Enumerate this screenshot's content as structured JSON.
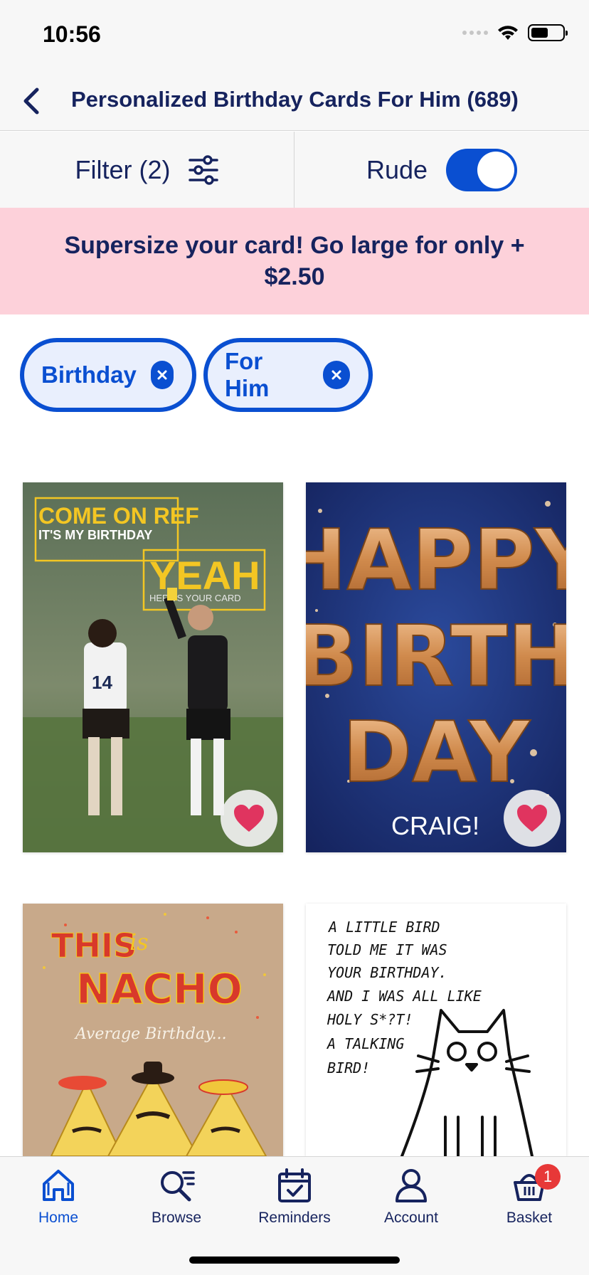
{
  "status_bar": {
    "time": "10:56"
  },
  "header": {
    "title": "Personalized Birthday Cards For Him (689)"
  },
  "filter_bar": {
    "filter_label": "Filter (2)",
    "rude_label": "Rude",
    "rude_enabled": true
  },
  "promo": {
    "text": "Supersize your card! Go large for only + $2.50"
  },
  "chips": [
    {
      "label": "Birthday"
    },
    {
      "label": "For Him"
    }
  ],
  "cards": [
    {
      "line1": "COME ON REF",
      "line2": "IT'S MY BIRTHDAY",
      "line3": "YEAH",
      "line4": "HERE'S YOUR CARD",
      "player_number": "14"
    },
    {
      "line1": "HAPPY",
      "line2": "BIRTH",
      "line3": "DAY",
      "name": "CRAIG!"
    },
    {
      "line1": "THIS",
      "line2": "is",
      "line3": "NACHO",
      "line4": "Average Birthday..."
    },
    {
      "lines": [
        "A LITTLE BIRD",
        "TOLD ME IT WAS",
        "YOUR BIRTHDAY.",
        "AND I WAS ALL LIKE",
        "HOLY S*?T!",
        "A TALKING",
        "BIRD!"
      ]
    }
  ],
  "tabs": [
    {
      "label": "Home",
      "icon": "home-icon",
      "active": true
    },
    {
      "label": "Browse",
      "icon": "browse-icon",
      "active": false
    },
    {
      "label": "Reminders",
      "icon": "calendar-icon",
      "active": false
    },
    {
      "label": "Account",
      "icon": "account-icon",
      "active": false
    },
    {
      "label": "Basket",
      "icon": "basket-icon",
      "active": false,
      "badge": "1"
    }
  ],
  "colors": {
    "accent": "#0a4fd1",
    "navy": "#16235e",
    "promo_bg": "#fdd1da",
    "heart": "#e0345f"
  }
}
